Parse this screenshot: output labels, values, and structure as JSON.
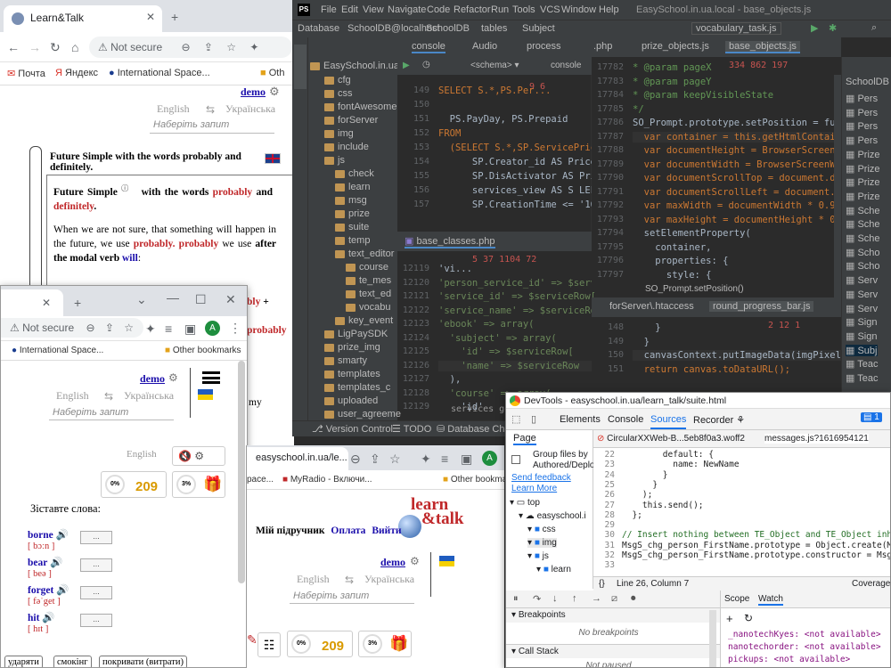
{
  "bg_browser": {
    "tab_title": "Learn&Talk",
    "url": "Not secure",
    "bookmarks": [
      "Почта",
      "Яндекс",
      "International Space...",
      "Oth"
    ],
    "user": "demo",
    "lang_from": "English",
    "lang_to": "Українська",
    "search_placeholder": "Наберіть запит",
    "heading": "Future Simple with the words probably and definitely.",
    "para_title_a": "Future Simple",
    "para_title_b": "with the words",
    "para_title_c": "probably",
    "para_title_d": "and",
    "para_title_e": "definitely",
    "para1": "When we are not sure, that something will happen in the future, we use",
    "p_probably": "probably.",
    "p_probably2": "probably",
    "p_we_use": "we use",
    "p_after": "after the modal verb",
    "p_will": "will",
    "frag1": "bly",
    "frag2": "+",
    "frag3": "probably",
    "frag4": "my"
  },
  "mid_browser": {
    "url": "Not secure",
    "bookmarks": [
      "International Space...",
      "Other bookmarks"
    ],
    "avatar": "A",
    "user": "demo",
    "lang_from": "English",
    "lang_to": "Українська",
    "search_placeholder": "Наберіть запит",
    "lang_label": "English",
    "progress0": "0%",
    "coins": "209",
    "progress3": "3%",
    "match_title": "Зіставте слова:",
    "words": [
      {
        "w": "borne",
        "t": "[ bɔːn ]"
      },
      {
        "w": "bear",
        "t": "[ beə ]"
      },
      {
        "w": "forget",
        "t": "[ fəˈget ]"
      },
      {
        "w": "hit",
        "t": "[ hɪt ]"
      }
    ],
    "dots": "...",
    "answers": [
      "ударяти",
      "смокінг",
      "покривати (витрати)"
    ]
  },
  "front_browser": {
    "tab_title": "easyschool.in.ua/le...",
    "bookmarks": [
      "pace...",
      "MyRadio - Включи...",
      "Other bookma"
    ],
    "avatar": "A",
    "logo_line1": "learn",
    "logo_line2": "&talk",
    "nav": [
      "Мій підручник",
      "Оплата",
      "Вийти"
    ],
    "user": "demo",
    "lang_from": "English",
    "lang_to": "Українська",
    "search_placeholder": "Наберіть запит",
    "progress0": "0%",
    "coins": "209",
    "progress3": "3%"
  },
  "ide": {
    "menu": [
      "File",
      "Edit",
      "View",
      "Navigate",
      "Code",
      "Refactor",
      "Run",
      "Tools",
      "VCS",
      "Window",
      "Help"
    ],
    "window_title": "EasySchool.in.ua.local - base_objects.js",
    "crumbs": [
      "Database",
      "SchoolDB@localhost",
      "SchoolDB",
      "tables",
      "Subject"
    ],
    "run_config": "vocabulary_task.js",
    "project_root": "EasySchool.in.ua",
    "tree": [
      "cfg",
      "css",
      "fontAwesome",
      "forServer",
      "img",
      "include",
      "js",
      "check",
      "learn",
      "msg",
      "prize",
      "suite",
      "temp",
      "text_editor",
      "course",
      "te_mes",
      "text_ed",
      "vocabu",
      "key_event",
      "LigPaySDK",
      "prize_img",
      "smarty",
      "templates",
      "templates_c",
      "uploaded",
      "user_agreeme"
    ],
    "tabs_top": [
      "console",
      "Audio",
      "process",
      "console"
    ],
    "tabs_right": [
      ".php",
      "prize_objects.js",
      "base_objects.js"
    ],
    "sql_lines": [
      "149",
      "150",
      "151",
      "152",
      "153",
      "154",
      "155",
      "156",
      "157"
    ],
    "sql_code": [
      "SELECT S.*,PS.Per...",
      "",
      "  PS.PayDay, PS.Prepaid",
      "FROM",
      "  (SELECT S.*,SP.ServicePrice_i...",
      "      SP.Creator_id AS PriceCreat...",
      "      SP.DisActivator AS PriceDisA...",
      "      services_view AS S LEFT JOIN ...",
      "      SP.CreationTime <= '1631002..."
    ],
    "sql_badges": "9  6",
    "php_tab": "base_classes.php",
    "php_badges": "5  37  1104  72",
    "php_lines": [
      "12119",
      "12120",
      "12121",
      "12122",
      "12123",
      "12124",
      "12125",
      "12126",
      "12127",
      "12128",
      "12129"
    ],
    "php_code": [
      "'vi...",
      "'person_service_id' => $servi",
      "'service_id' => $serviceRow[",
      "'service_name' => $serviceRo",
      "'ebook' => array(",
      "  'subject' => array(",
      "    'id' => $serviceRow[",
      "    'name' => $serviceRow",
      "  ),",
      "  'course' => array(",
      "    'id'"
    ],
    "php_crumb": "services  get",
    "js_lines": [
      "17782",
      "17783",
      "17784",
      "17785",
      "17786",
      "17787",
      "17788",
      "17789",
      "17790",
      "17791",
      "17792",
      "17793",
      "17794",
      "17795",
      "17796",
      "17797"
    ],
    "js_badges": "334  862  197",
    "js_code": [
      "* @param pageX",
      "* @param pageY",
      "* @param keepVisibleState",
      "*/",
      "SO_Prompt.prototype.setPosition = funct",
      "  var container = this.getHtmlContain",
      "  var documentHeight = BrowserScreenH",
      "  var documentWidth = BrowserScreenW",
      "  var documentScrollTop = document.do",
      "  var documentScrollLeft = document.d",
      "  var maxWidth = documentWidth * 0.9",
      "  var maxHeight = documentHeight * 0.",
      "  setElementProperty(",
      "    container,",
      "    properties: {",
      "      style: {"
    ],
    "js_hint": "SO_Prompt.setPosition()",
    "lower_tabs": [
      "forServer\\.htaccess",
      "round_progress_bar.js"
    ],
    "lower_badges": "2  12  1",
    "lower_lines": [
      "148",
      "149",
      "150",
      "151"
    ],
    "lower_code": [
      "    }",
      "  }",
      "  canvasContext.putImageData(imgPixels,",
      "  return canvas.toDataURL();"
    ],
    "right_panel": "SchoolDB",
    "right_items": [
      "Pers",
      "Pers",
      "Pers",
      "Pers",
      "Prize",
      "Prize",
      "Prize",
      "Prize",
      "Sche",
      "Sche",
      "Sche",
      "Scho",
      "Scho",
      "Serv",
      "Serv",
      "Serv",
      "Sign",
      "Sign",
      "Subj",
      "Teac",
      "Teac"
    ],
    "status": [
      "Version Control",
      "TODO",
      "Database Chang"
    ]
  },
  "devtools": {
    "title": "DevTools - easyschool.in.ua/learn_talk/suite.html",
    "tabs": [
      "Elements",
      "Console",
      "Sources",
      "Recorder"
    ],
    "badge": "1",
    "page_tab": "Page",
    "file_tabs": [
      "CircularXXWeb-B...5eb8f0a3.woff2",
      "messages.js?1616954121"
    ],
    "group_label": "Group files by Authored/Deployed",
    "send_feedback": "Send feedback",
    "learn_more": "Learn More",
    "tree": [
      "top",
      "easyschool.i",
      "css",
      "img",
      "js",
      "learn"
    ],
    "line_nums": [
      "22",
      "23",
      "24",
      "25",
      "26",
      "27",
      "28",
      "29",
      "30",
      "31",
      "32",
      "33"
    ],
    "code": [
      "        default: {",
      "          name: NewName",
      "        }",
      "      }",
      "    );",
      "    this.send();",
      "  };",
      "",
      "// Insert nothing between TE_Object and TE_Object inheritance",
      "MsgS_chg_person_FirstName.prototype = Object.create(MsgS_messa",
      "MsgS_chg_person_FirstName.prototype.constructor = MsgS_chg_pe",
      ""
    ],
    "cursor": "Line 26, Column 7",
    "coverage": "Coverage:",
    "breakpoints": "Breakpoints",
    "no_breakpoints": "No breakpoints",
    "call_stack": "Call Stack",
    "not_paused": "Not paused",
    "scope": "Scope",
    "watch": "Watch",
    "watch_items": [
      "_nanotechKyes: <not available>",
      "nanotechorder: <not available>",
      "pickups: <not available>"
    ]
  }
}
